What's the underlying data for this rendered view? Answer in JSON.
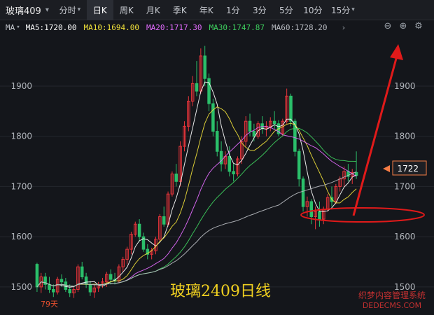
{
  "header": {
    "symbol": "玻璃409",
    "tabs": [
      {
        "label": "分时",
        "dd": true
      },
      {
        "label": "日K",
        "dd": false,
        "selected": true
      },
      {
        "label": "周K",
        "dd": false
      },
      {
        "label": "月K",
        "dd": false
      },
      {
        "label": "季K",
        "dd": false
      },
      {
        "label": "年K",
        "dd": false
      },
      {
        "label": "1分",
        "dd": false
      },
      {
        "label": "3分",
        "dd": false
      },
      {
        "label": "5分",
        "dd": false
      },
      {
        "label": "10分",
        "dd": false
      },
      {
        "label": "15分",
        "dd": true
      }
    ]
  },
  "ma_bar": {
    "label": "MA",
    "items": [
      {
        "text": "MA5:1720.00",
        "color": "#ffffff"
      },
      {
        "text": "MA10:1694.00",
        "color": "#f0e03a"
      },
      {
        "text": "MA20:1717.30",
        "color": "#e36cff"
      },
      {
        "text": "MA30:1747.87",
        "color": "#3ecf5e"
      },
      {
        "text": "MA60:1728.20",
        "color": "#b9bcc2"
      }
    ],
    "more": "›"
  },
  "toolbar": {
    "zoom_out": "⊖",
    "zoom_in": "⊕",
    "settings": "⚙"
  },
  "chart_data": {
    "type": "candlestick",
    "title": "玻璃2409日线",
    "y_ticks": [
      1500,
      1600,
      1700,
      1800,
      1900
    ],
    "ylim": [
      1465,
      1985
    ],
    "current_price": "1722",
    "days_label": "79天",
    "watermark": [
      "织梦内容管理系统",
      "DEDECMS.COM"
    ],
    "ohlc": [
      [
        1545,
        1548,
        1490,
        1500
      ],
      [
        1500,
        1528,
        1488,
        1520
      ],
      [
        1520,
        1528,
        1495,
        1505
      ],
      [
        1505,
        1520,
        1488,
        1495
      ],
      [
        1495,
        1505,
        1480,
        1490
      ],
      [
        1490,
        1520,
        1485,
        1515
      ],
      [
        1515,
        1525,
        1500,
        1510
      ],
      [
        1510,
        1518,
        1490,
        1495
      ],
      [
        1495,
        1505,
        1480,
        1488
      ],
      [
        1488,
        1500,
        1478,
        1495
      ],
      [
        1495,
        1545,
        1490,
        1540
      ],
      [
        1540,
        1550,
        1515,
        1520
      ],
      [
        1520,
        1528,
        1498,
        1505
      ],
      [
        1505,
        1512,
        1482,
        1490
      ],
      [
        1490,
        1505,
        1478,
        1498
      ],
      [
        1498,
        1510,
        1490,
        1505
      ],
      [
        1505,
        1518,
        1498,
        1510
      ],
      [
        1510,
        1530,
        1500,
        1525
      ],
      [
        1525,
        1535,
        1505,
        1515
      ],
      [
        1515,
        1528,
        1505,
        1512
      ],
      [
        1512,
        1545,
        1508,
        1540
      ],
      [
        1540,
        1560,
        1530,
        1555
      ],
      [
        1555,
        1580,
        1545,
        1575
      ],
      [
        1575,
        1610,
        1565,
        1605
      ],
      [
        1605,
        1630,
        1600,
        1625
      ],
      [
        1625,
        1635,
        1590,
        1600
      ],
      [
        1600,
        1608,
        1570,
        1575
      ],
      [
        1575,
        1585,
        1555,
        1565
      ],
      [
        1565,
        1578,
        1555,
        1572
      ],
      [
        1572,
        1600,
        1565,
        1595
      ],
      [
        1595,
        1645,
        1590,
        1640
      ],
      [
        1640,
        1660,
        1620,
        1625
      ],
      [
        1625,
        1690,
        1620,
        1685
      ],
      [
        1685,
        1730,
        1680,
        1725
      ],
      [
        1725,
        1745,
        1700,
        1710
      ],
      [
        1710,
        1790,
        1700,
        1780
      ],
      [
        1780,
        1830,
        1770,
        1820
      ],
      [
        1820,
        1880,
        1810,
        1870
      ],
      [
        1870,
        1920,
        1860,
        1905
      ],
      [
        1905,
        1950,
        1880,
        1890
      ],
      [
        1890,
        1975,
        1885,
        1960
      ],
      [
        1960,
        1980,
        1900,
        1915
      ],
      [
        1915,
        1925,
        1850,
        1865
      ],
      [
        1865,
        1875,
        1800,
        1810
      ],
      [
        1810,
        1830,
        1760,
        1770
      ],
      [
        1770,
        1790,
        1730,
        1745
      ],
      [
        1745,
        1770,
        1735,
        1760
      ],
      [
        1760,
        1780,
        1720,
        1730
      ],
      [
        1730,
        1745,
        1710,
        1725
      ],
      [
        1725,
        1760,
        1720,
        1755
      ],
      [
        1755,
        1800,
        1745,
        1790
      ],
      [
        1790,
        1840,
        1780,
        1830
      ],
      [
        1830,
        1845,
        1800,
        1810
      ],
      [
        1810,
        1825,
        1790,
        1800
      ],
      [
        1800,
        1830,
        1795,
        1825
      ],
      [
        1825,
        1840,
        1805,
        1815
      ],
      [
        1815,
        1830,
        1800,
        1820
      ],
      [
        1820,
        1838,
        1810,
        1830
      ],
      [
        1830,
        1850,
        1815,
        1825
      ],
      [
        1825,
        1832,
        1800,
        1805
      ],
      [
        1805,
        1835,
        1800,
        1830
      ],
      [
        1830,
        1895,
        1825,
        1880
      ],
      [
        1880,
        1885,
        1820,
        1830
      ],
      [
        1830,
        1835,
        1760,
        1770
      ],
      [
        1770,
        1775,
        1700,
        1715
      ],
      [
        1715,
        1720,
        1650,
        1660
      ],
      [
        1660,
        1680,
        1640,
        1670
      ],
      [
        1670,
        1675,
        1625,
        1640
      ],
      [
        1640,
        1660,
        1615,
        1650
      ],
      [
        1650,
        1670,
        1620,
        1635
      ],
      [
        1635,
        1660,
        1625,
        1655
      ],
      [
        1655,
        1685,
        1650,
        1678
      ],
      [
        1678,
        1700,
        1660,
        1670
      ],
      [
        1670,
        1705,
        1665,
        1700
      ],
      [
        1700,
        1720,
        1690,
        1715
      ],
      [
        1715,
        1740,
        1700,
        1730
      ],
      [
        1730,
        1745,
        1710,
        1720
      ],
      [
        1720,
        1735,
        1705,
        1728
      ],
      [
        1728,
        1770,
        1715,
        1722
      ]
    ]
  }
}
